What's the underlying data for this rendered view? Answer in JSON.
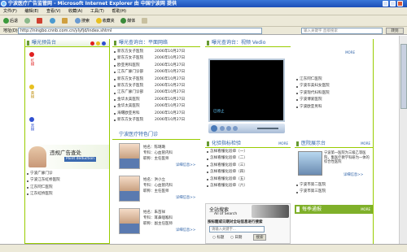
{
  "window": {
    "title": "宁波医疗广告监管网 - Microsoft Internet Explorer 由 中国宁波网 提供"
  },
  "menu": [
    "文件(F)",
    "编辑(E)",
    "查看(V)",
    "收藏(A)",
    "工具(T)",
    "帮助(H)"
  ],
  "toolbar": {
    "back": "后退",
    "search": "搜索",
    "favorites": "收藏夹",
    "media": "媒体"
  },
  "address": {
    "label": "地址(D)",
    "url": "http://ningbo.cnnb.com.cn/ylyfjd/index.shtml",
    "search_placeholder": "输入关键字 直接搜索",
    "go": "转到"
  },
  "left": {
    "title": "曝光预告台",
    "lights": [
      {
        "label": "红榜",
        "color": "#e02020"
      },
      {
        "label": "黄榜",
        "color": "#e8c020"
      },
      {
        "label": "黑榜",
        "color": "#3050d0"
      }
    ],
    "badge_title": "违规广告查处",
    "badge_sub": "Point deduction",
    "links": [
      "宁波广廊门诊",
      "宁波江东虹桥医院",
      "江东阿仁医院",
      "江东虹桥医院"
    ]
  },
  "middle": {
    "title": "曝光查询台：平面网络",
    "news": [
      {
        "text": "新东方女子医院",
        "date": "2006年10月27日"
      },
      {
        "text": "新东方女子医院",
        "date": "2006年10月27日"
      },
      {
        "text": "欧亚男科医院",
        "date": "2006年10月27日"
      },
      {
        "text": "江东广廊门诊部",
        "date": "2006年10月27日"
      },
      {
        "text": "新东方女子医院",
        "date": "2006年10月27日"
      },
      {
        "text": "新东方女子医院",
        "date": "2006年10月27日"
      },
      {
        "text": "江东广廊门诊部",
        "date": "2006年10月27日"
      },
      {
        "text": "金华太美医院",
        "date": "2006年10月27日"
      },
      {
        "text": "金华太美医院",
        "date": "2006年10月27日"
      },
      {
        "text": "海曙欧亚男科",
        "date": "2006年10月27日"
      },
      {
        "text": "新东方女子医院",
        "date": "2006年10月27日"
      }
    ],
    "doctor_title": "宁波医疗特色门诊",
    "doctors": [
      {
        "name": "姓名：陈璐璐",
        "dept": "专科：心血管内科",
        "job": "职称：主任医师",
        "more": "详细信息>>"
      },
      {
        "name": "姓名：洪小立",
        "dept": "专科：心血管内科",
        "job": "职称：主任医师",
        "more": "详细信息>>"
      },
      {
        "name": "姓名：朱苗祥",
        "dept": "专科：耳鼻咽喉科",
        "job": "职称：副主任医师",
        "more": "详细信息>>"
      }
    ]
  },
  "video": {
    "title": "曝光查询台：视频 Vedio",
    "more": "MORE",
    "caption": "已停止",
    "links": [
      "江东阿仁医院",
      "宁波华美妇女医院",
      "宁波现代妇科医院",
      "宁波博爱医院",
      "宁波欧亚男科"
    ]
  },
  "check": {
    "title": "化验指标检验",
    "more": "MORE",
    "items": [
      "怎样看懂化验单（一）",
      "怎样看懂化验单（二）",
      "怎样看懂化验单（三）",
      "怎样看懂化验单（四）",
      "怎样看懂化验单（五）",
      "怎样看懂化验单（六）"
    ]
  },
  "hospital": {
    "title": "医院展示台",
    "more": "MORE",
    "name": "宁波第一医院",
    "desc": "宁波第一医院为三级乙等医院，集医疗教学科研为一体的综合性医院",
    "more_link": "详细信息>>",
    "links": [
      "宁波市第二医院",
      "宁波市第三医院"
    ]
  },
  "search": {
    "title": "全站搜索",
    "subtitle": "All of Search",
    "hint": "按标题或日期对全站信息进行搜索",
    "placeholder": "请输入关键字...",
    "opt1": "标题",
    "opt2": "日期",
    "button": "搜索"
  },
  "bulletin": {
    "title": "每季通报",
    "more": "MORE"
  }
}
